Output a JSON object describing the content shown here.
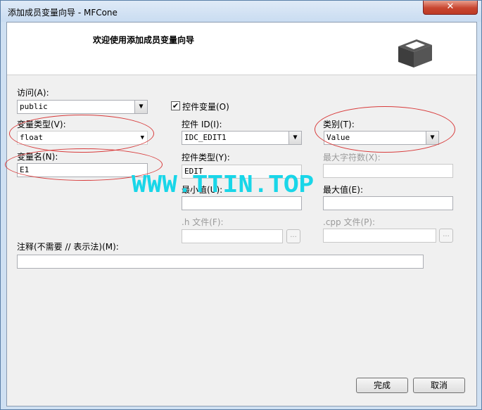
{
  "window": {
    "title": "添加成员变量向导 - MFCone",
    "close_glyph": "✕"
  },
  "banner": {
    "title": "欢迎使用添加成员变量向导",
    "logo_icon": "package-box-icon"
  },
  "access": {
    "label": "访问(A):",
    "value": "public"
  },
  "var_type": {
    "label": "变量类型(V):",
    "value": "float"
  },
  "var_name": {
    "label": "变量名(N):",
    "value": "E1"
  },
  "control_var": {
    "label": "控件变量(O)",
    "checked": true
  },
  "control_id": {
    "label": "控件 ID(I):",
    "value": "IDC_EDIT1"
  },
  "control_type": {
    "label": "控件类型(Y):",
    "value": "EDIT"
  },
  "min_value": {
    "label": "最小值(U):",
    "value": ""
  },
  "h_file": {
    "label": ".h 文件(F):",
    "value": "",
    "browse": "..."
  },
  "category": {
    "label": "类别(T):",
    "value": "Value"
  },
  "max_chars": {
    "label": "最大字符数(X):",
    "value": ""
  },
  "max_value": {
    "label": "最大值(E):",
    "value": ""
  },
  "cpp_file": {
    "label": ".cpp 文件(P):",
    "value": "",
    "browse": "..."
  },
  "comment": {
    "label": "注释(不需要 // 表示法)(M):",
    "value": ""
  },
  "buttons": {
    "finish": "完成",
    "cancel": "取消"
  },
  "watermark": "WWW.TTIN.TOP",
  "colors": {
    "annotation_circle": "#d83b3b",
    "watermark": "#19d6e8"
  }
}
